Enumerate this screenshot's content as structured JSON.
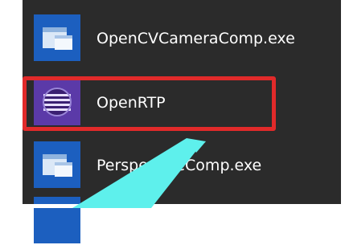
{
  "start_menu": {
    "items": [
      {
        "label": "OpenCVCameraComp.exe",
        "icon": "exe-app-icon"
      },
      {
        "label": "OpenRTP",
        "icon": "openrtp-sphere-icon"
      },
      {
        "label": "PerspectiveComp.exe",
        "icon": "exe-app-icon"
      },
      {
        "label": "",
        "icon": "exe-app-icon"
      }
    ]
  },
  "annotation": {
    "highlight_color": "#e12a2a",
    "arrow_color": "#5ef0ec"
  }
}
